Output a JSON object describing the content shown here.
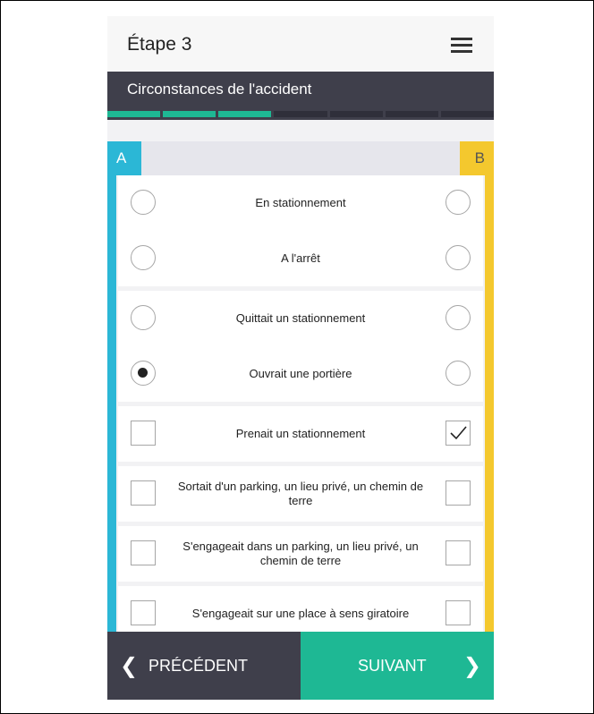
{
  "header": {
    "title": "Étape 3",
    "menu_icon": "hamburger-menu-icon"
  },
  "section": {
    "title": "Circonstances de l'accident"
  },
  "progress": {
    "segments_total": 7,
    "segments_done": 3
  },
  "columns": {
    "a_label": "A",
    "b_label": "B",
    "a_color": "#2bb7d6",
    "b_color": "#f4c82e"
  },
  "groups": [
    {
      "type": "radio",
      "rows": [
        {
          "label": "En stationnement",
          "a": false,
          "b": false
        },
        {
          "label": "A l'arrêt",
          "a": false,
          "b": false
        }
      ]
    },
    {
      "type": "radio",
      "rows": [
        {
          "label": "Quittait un stationnement",
          "a": false,
          "b": false
        },
        {
          "label": "Ouvrait une portière",
          "a": true,
          "b": false
        }
      ]
    },
    {
      "type": "checkbox",
      "rows": [
        {
          "label": "Prenait un stationnement",
          "a": false,
          "b": true
        }
      ]
    },
    {
      "type": "checkbox",
      "rows": [
        {
          "label": "Sortait d'un parking, un lieu privé, un chemin de terre",
          "a": false,
          "b": false
        }
      ]
    },
    {
      "type": "checkbox",
      "rows": [
        {
          "label": "S'engageait dans un parking, un lieu privé, un chemin de terre",
          "a": false,
          "b": false
        }
      ]
    },
    {
      "type": "checkbox",
      "rows": [
        {
          "label": "S'engageait sur une place à sens giratoire",
          "a": false,
          "b": false
        }
      ]
    }
  ],
  "nav": {
    "prev_label": "PRÉCÉDENT",
    "next_label": "SUIVANT",
    "prev_icon": "chevron-left-icon",
    "next_icon": "chevron-right-icon"
  },
  "colors": {
    "accent": "#1eb894",
    "dark": "#3f3f4b"
  }
}
